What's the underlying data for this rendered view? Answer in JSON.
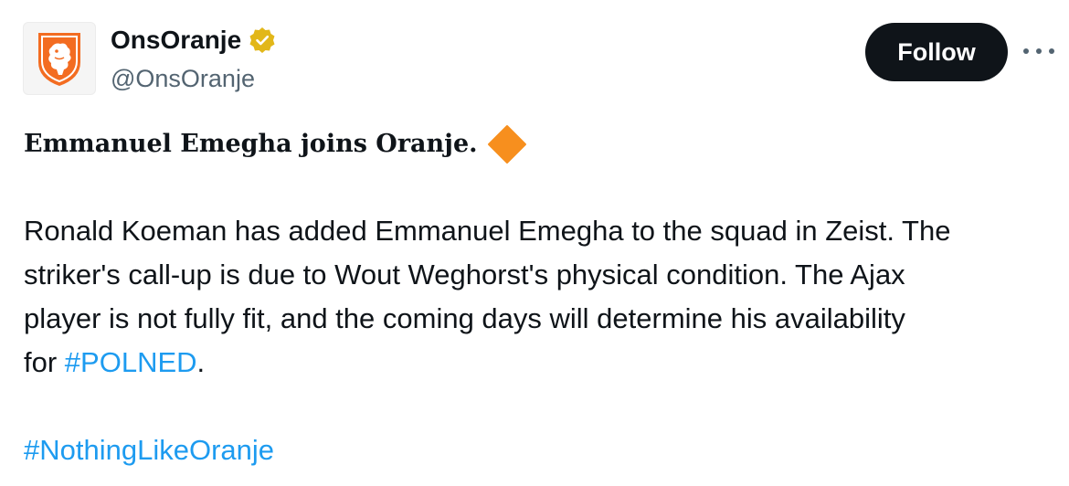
{
  "author": {
    "display_name": "OnsOranje",
    "handle": "@OnsOranje",
    "verified": true,
    "avatar_icon": "lion-crest-icon",
    "verified_icon": "gold-verified-badge-icon"
  },
  "actions": {
    "follow_label": "Follow",
    "more_icon": "more-options-icon"
  },
  "post": {
    "headline": "Emmanuel Emegha joins Oranje.",
    "headline_emoji": "orange-diamond-icon",
    "body_line_1": "Ronald Koeman has added Emmanuel Emegha to the squad in Zeist. The",
    "body_line_2": "striker's call-up is due to Wout Weghorst's physical condition. The Ajax",
    "body_line_3": "player is not fully fit, and the coming days will determine his availability",
    "body_line_4_prefix": "for ",
    "hashtag_1": "#POLNED",
    "body_line_4_suffix": ".",
    "hashtag_2": "#NothingLikeOranje"
  },
  "colors": {
    "accent_blue": "#1d9bf0",
    "text_primary": "#0f1419",
    "text_secondary": "#536471",
    "brand_orange": "#f36c21",
    "follow_bg": "#0f1419",
    "verified_gold": "#e2b719"
  }
}
